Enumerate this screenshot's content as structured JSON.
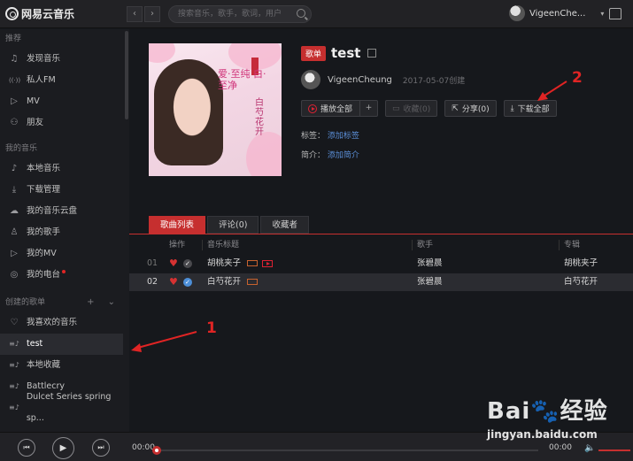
{
  "app": {
    "logo_text": "网易云音乐",
    "brand_color": "#c62f2f"
  },
  "topbar": {
    "back": "‹",
    "forward": "›",
    "search_placeholder": "搜索音乐，歌手，歌词，用户",
    "username": "VigeenChe...",
    "caret": "▾"
  },
  "sidebar": {
    "recommend_title": "推荐",
    "recommend": [
      {
        "icon": "♫",
        "label": "发现音乐"
      },
      {
        "icon": "((·))",
        "label": "私人FM"
      },
      {
        "icon": "▷",
        "label": "MV"
      },
      {
        "icon": "⚇",
        "label": "朋友"
      }
    ],
    "mymusic_title": "我的音乐",
    "mymusic": [
      {
        "icon": "♪",
        "label": "本地音乐"
      },
      {
        "icon": "⤓",
        "label": "下载管理"
      },
      {
        "icon": "☁",
        "label": "我的音乐云盘"
      },
      {
        "icon": "♙",
        "label": "我的歌手"
      },
      {
        "icon": "▷",
        "label": "我的MV"
      },
      {
        "icon": "◎",
        "label": "我的电台"
      }
    ],
    "created_title": "创建的歌单",
    "created_actions": "+ ⌄",
    "created": [
      {
        "icon": "♡",
        "label": "我喜欢的音乐"
      },
      {
        "icon": "≡♪",
        "label": "test",
        "active": true
      },
      {
        "icon": "≡♪",
        "label": "本地收藏"
      },
      {
        "icon": "≡♪",
        "label": "Battlecry"
      },
      {
        "icon": "≡♪",
        "label": "Dulcet Series spring sp..."
      }
    ]
  },
  "playlist": {
    "badge": "歌单",
    "title": "test",
    "creator": "VigeenCheung",
    "created": "2017-05-07创建",
    "cover_text": "爱·至纯 白·至净",
    "cover_text2": "白芍花开",
    "buttons": {
      "play_all": "播放全部",
      "plus": "+",
      "collect": "收藏(0)",
      "share": "分享(0)",
      "download_all": "下载全部"
    },
    "tags_label": "标签：",
    "tags_link": "添加标签",
    "intro_label": "简介：",
    "intro_link": "添加简介"
  },
  "tabs": [
    "歌曲列表",
    "评论(0)",
    "收藏者"
  ],
  "table": {
    "headers": {
      "op": "操作",
      "title": "音乐标题",
      "artist": "歌手",
      "album": "专辑"
    },
    "rows": [
      {
        "num": "01",
        "title": "胡桃夹子",
        "artist": "张碧晨",
        "album": "胡桃夹子"
      },
      {
        "num": "02",
        "title": "白芍花开",
        "artist": "张碧晨",
        "album": "白芍花开"
      }
    ]
  },
  "player": {
    "prev": "⏮",
    "play": "▶",
    "next": "⏭",
    "time_current": "00:00",
    "time_total": "00:00",
    "progress": 0
  },
  "annotations": {
    "one": "1",
    "two": "2"
  },
  "watermark": {
    "main": "Bai🐾经验",
    "sub": "jingyan.baidu.com"
  }
}
